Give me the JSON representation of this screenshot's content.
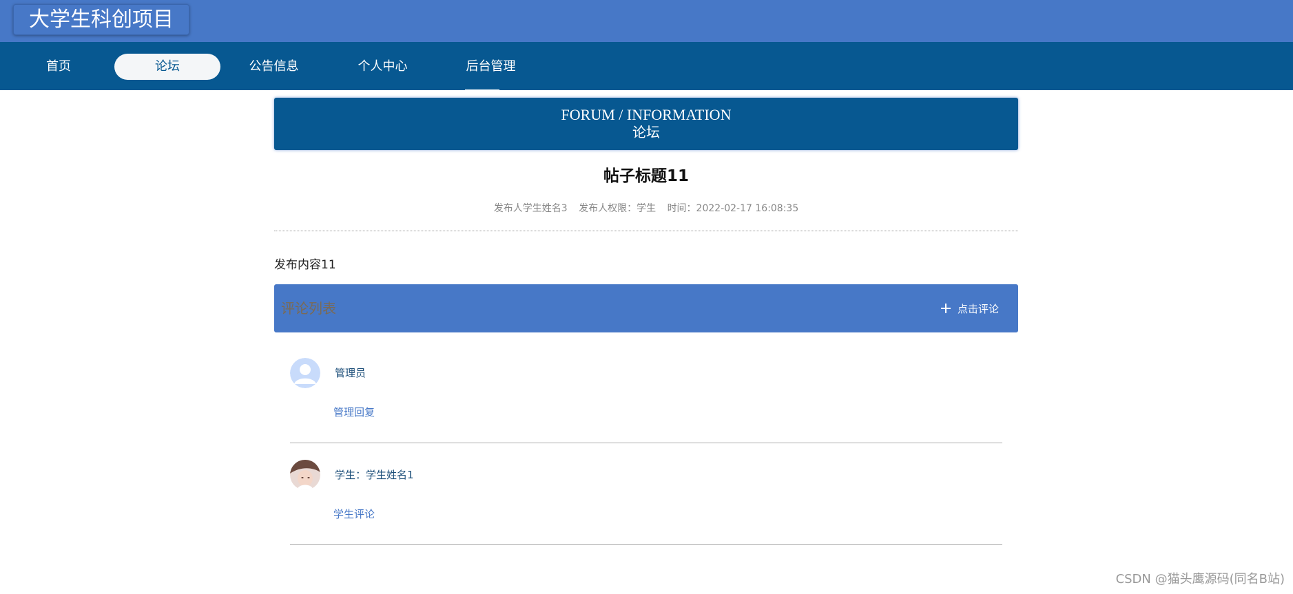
{
  "header": {
    "site_title": "大学生科创项目"
  },
  "nav": {
    "items": [
      {
        "label": "首页"
      },
      {
        "label": "论坛",
        "active": true
      },
      {
        "label": "公告信息"
      },
      {
        "label": "个人中心"
      },
      {
        "label": "后台管理"
      }
    ]
  },
  "banner": {
    "english": "FORUM / INFORMATION",
    "chinese": "论坛"
  },
  "post": {
    "title": "帖子标题11",
    "author": "发布人学生姓名3",
    "role": "发布人权限：学生",
    "time": "时间：2022-02-17 16:08:35",
    "content": "发布内容11"
  },
  "comments": {
    "title": "评论列表",
    "add_button_label": "点击评论",
    "items": [
      {
        "author": "管理员",
        "text": "管理回复",
        "avatar_icon": "default-user-icon"
      },
      {
        "author": "学生：学生姓名1",
        "text": "学生评论",
        "avatar_icon": "photo-avatar"
      }
    ]
  },
  "watermark": "CSDN @猫头鹰源码(同名B站)",
  "colors": {
    "header_blue": "#4778c7",
    "nav_dark_blue": "#075891",
    "active_tab_bg": "#f4f6f8"
  }
}
